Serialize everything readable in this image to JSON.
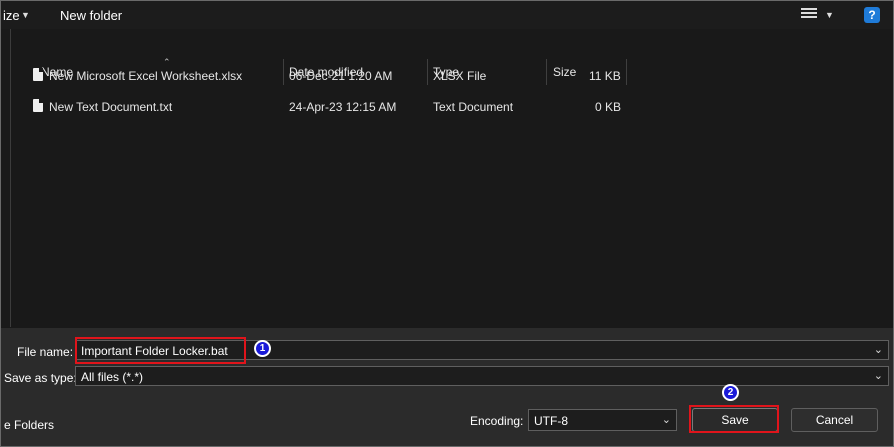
{
  "toolbar": {
    "organize_label": "ize",
    "new_folder_label": "New folder",
    "help_label": "?",
    "view_icon": "list-view-icon"
  },
  "columns": {
    "name": "Name",
    "date": "Date modified",
    "type": "Type",
    "size": "Size"
  },
  "files": [
    {
      "name": "New Microsoft Excel Worksheet.xlsx",
      "date": "06-Dec-21 1:20 AM",
      "type": "XLSX File",
      "size": "11 KB"
    },
    {
      "name": "New Text Document.txt",
      "date": "24-Apr-23 12:15 AM",
      "type": "Text Document",
      "size": "0 KB"
    }
  ],
  "form": {
    "file_name_label": "File name:",
    "file_name_value": "Important Folder Locker.bat",
    "save_type_label": "Save as type:",
    "save_type_value": "All files  (*.*)",
    "hide_folders_label": "e Folders",
    "encoding_label": "Encoding:",
    "encoding_value": "UTF-8",
    "save_label": "Save",
    "cancel_label": "Cancel"
  },
  "annotations": {
    "step1": "1",
    "step2": "2",
    "callout_color": "#e0141b",
    "badge_color": "#1a1ad8"
  }
}
